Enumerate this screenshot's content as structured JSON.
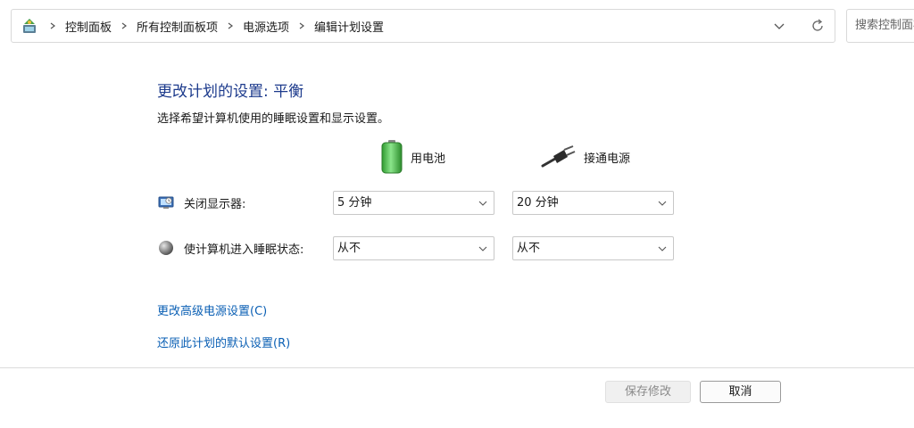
{
  "address_bar": {
    "breadcrumbs": [
      "控制面板",
      "所有控制面板项",
      "电源选项",
      "编辑计划设置"
    ],
    "search_placeholder": "搜索控制面板"
  },
  "main": {
    "title": "更改计划的设置: 平衡",
    "description": "选择希望计算机使用的睡眠设置和显示设置。",
    "columns": {
      "battery_label": "用电池",
      "plugged_label": "接通电源"
    },
    "rows": [
      {
        "label": "关闭显示器:",
        "battery_value": "5 分钟",
        "plugged_value": "20 分钟"
      },
      {
        "label": "使计算机进入睡眠状态:",
        "battery_value": "从不",
        "plugged_value": "从不"
      }
    ],
    "links": {
      "advanced": "更改高级电源设置(C)",
      "restore": "还原此计划的默认设置(R)"
    }
  },
  "footer": {
    "save_label": "保存修改",
    "cancel_label": "取消"
  },
  "colors": {
    "title": "#1c3a8c",
    "link": "#0a5fb4",
    "battery_green": "#3fbf3f"
  },
  "icons": [
    "control-panel-icon",
    "chevron-right-icon",
    "chevron-down-icon",
    "refresh-icon",
    "battery-icon",
    "power-plug-icon",
    "monitor-icon",
    "sleep-moon-icon"
  ]
}
